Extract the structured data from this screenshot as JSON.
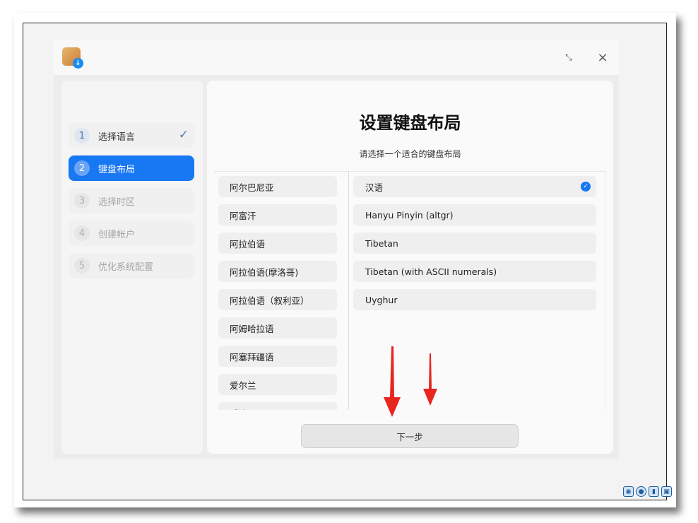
{
  "window": {
    "logo_badge": "↓",
    "minimize_glyph": "⤡",
    "close_glyph": "×"
  },
  "sidebar": {
    "steps": [
      {
        "num": "1",
        "label": "选择语言",
        "state": "done",
        "check": "✓"
      },
      {
        "num": "2",
        "label": "键盘布局",
        "state": "active"
      },
      {
        "num": "3",
        "label": "选择时区",
        "state": "disabled"
      },
      {
        "num": "4",
        "label": "创建帐户",
        "state": "disabled"
      },
      {
        "num": "5",
        "label": "优化系统配置",
        "state": "disabled"
      }
    ]
  },
  "main": {
    "title": "设置键盘布局",
    "subtitle": "请选择一个适合的键盘布局",
    "languages": [
      "阿尔巴尼亚",
      "阿富汗",
      "阿拉伯语",
      "阿拉伯语(摩洛哥)",
      "阿拉伯语（叙利亚）",
      "阿姆哈拉语",
      "阿塞拜疆语",
      "爱尔兰",
      "爱沙尼亚"
    ],
    "layouts": [
      "汉语",
      "Hanyu Pinyin (altgr)",
      "Tibetan",
      "Tibetan (with ASCII numerals)",
      "Uyghur"
    ],
    "selected_check": "✓",
    "next_label": "下一步"
  },
  "colors": {
    "accent": "#1877f2",
    "arrow": "#e8251f"
  },
  "vm_icons": [
    "disc-icon",
    "cd-icon",
    "usb-icon",
    "network-icon"
  ]
}
